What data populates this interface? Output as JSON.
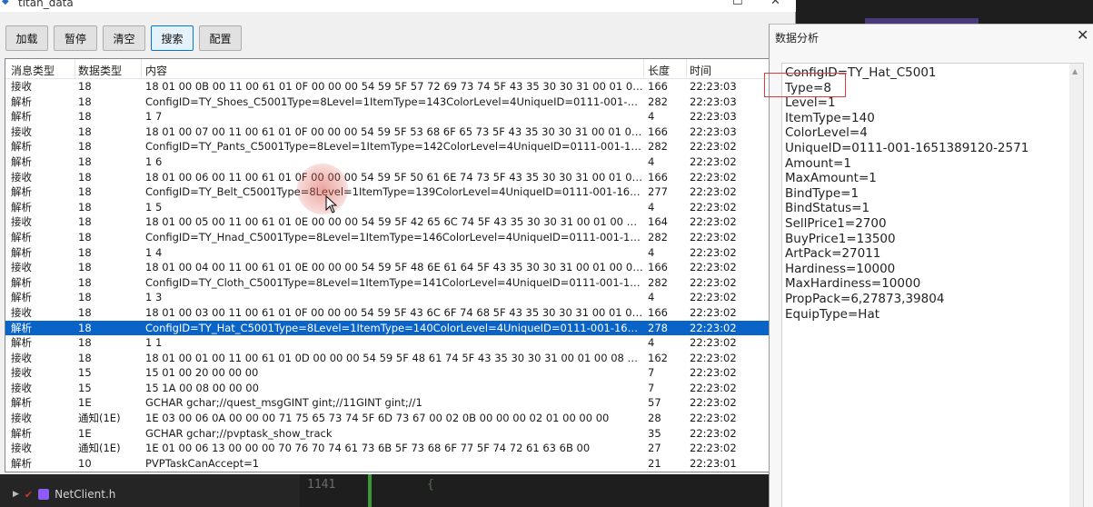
{
  "window": {
    "title": "titan_data"
  },
  "toolbar": {
    "buttons": [
      "加载",
      "暂停",
      "清空",
      "搜索",
      "配置"
    ]
  },
  "table": {
    "headers": [
      "消息类型",
      "数据类型",
      "内容",
      "长度",
      "时间"
    ],
    "rows": [
      [
        "接收",
        "18",
        "18 01 00 0B 00 11 00 61 01 0F 00 00 00 54 59 5F 57 72 69 73 74 5F 43 35 30 30 31 00 01 00 08 07 ...",
        "166",
        "22:23:03"
      ],
      [
        "解析",
        "18",
        "ConfigID=TY_Shoes_C5001Type=8Level=1ItemType=143ColorLevel=4UniqueID=0111-001-165138912...",
        "282",
        "22:23:03"
      ],
      [
        "解析",
        "18",
        "1 7",
        "4",
        "22:23:03"
      ],
      [
        "接收",
        "18",
        "18 01 00 07 00 11 00 61 01 0F 00 00 00 54 59 5F 53 68 6F 65 73 5F 43 35 30 30 31 00 01 00 08 07 ...",
        "166",
        "22:23:03"
      ],
      [
        "解析",
        "18",
        "ConfigID=TY_Pants_C5001Type=8Level=1ItemType=142ColorLevel=4UniqueID=0111-001-165138912...",
        "282",
        "22:23:02"
      ],
      [
        "解析",
        "18",
        "1 6",
        "4",
        "22:23:02"
      ],
      [
        "接收",
        "18",
        "18 01 00 06 00 11 00 61 01 0F 00 00 00 54 59 5F 50 61 6E 74 73 5F 43 35 30 30 31 00 01 00 08 07 ...",
        "166",
        "22:23:02"
      ],
      [
        "解析",
        "18",
        "ConfigID=TY_Belt_C5001Type=8Level=1ItemType=139ColorLevel=4UniqueID=0111-001-1651389120-...",
        "277",
        "22:23:02"
      ],
      [
        "解析",
        "18",
        "1 5",
        "4",
        "22:23:02"
      ],
      [
        "接收",
        "18",
        "18 01 00 05 00 11 00 61 01 0E 00 00 00 54 59 5F 42 65 6C 74 5F 43 35 30 30 31 00 01 00 08 07 00 ...",
        "164",
        "22:23:02"
      ],
      [
        "解析",
        "18",
        "ConfigID=TY_Hnad_C5001Type=8Level=1ItemType=146ColorLevel=4UniqueID=0111-001-165138912...",
        "282",
        "22:23:02"
      ],
      [
        "解析",
        "18",
        "1 4",
        "4",
        "22:23:02"
      ],
      [
        "接收",
        "18",
        "18 01 00 04 00 11 00 61 01 0E 00 00 00 54 59 5F 48 6E 61 64 5F 43 35 30 30 31 00 01 00 08 07 00 ...",
        "166",
        "22:23:02"
      ],
      [
        "解析",
        "18",
        "ConfigID=TY_Cloth_C5001Type=8Level=1ItemType=141ColorLevel=4UniqueID=0111-001-165138912...",
        "282",
        "22:23:02"
      ],
      [
        "解析",
        "18",
        "1 3",
        "4",
        "22:23:02"
      ],
      [
        "接收",
        "18",
        "18 01 00 03 00 11 00 61 01 0F 00 00 00 54 59 5F 43 6C 6F 74 68 5F 43 35 30 30 31 00 01 00 08 07 ...",
        "166",
        "22:23:02"
      ],
      [
        "解析",
        "18",
        "ConfigID=TY_Hat_C5001Type=8Level=1ItemType=140ColorLevel=4UniqueID=0111-001-1651389120-...",
        "278",
        "22:23:02"
      ],
      [
        "解析",
        "18",
        "1 1",
        "4",
        "22:23:02"
      ],
      [
        "接收",
        "18",
        "18 01 00 01 00 11 00 61 01 0D 00 00 00 54 59 5F 48 61 74 5F 43 35 30 30 31 00 01 00 08 07 00 01 ...",
        "162",
        "22:23:02"
      ],
      [
        "接收",
        "15",
        "15 01 00 20 00 00 00",
        "7",
        "22:23:02"
      ],
      [
        "接收",
        "15",
        "15 1A 00 08 00 00 00",
        "7",
        "22:23:02"
      ],
      [
        "解析",
        "1E",
        "GCHAR gchar;//quest_msgGINT gint;//11GINT gint;//1",
        "57",
        "22:23:02"
      ],
      [
        "接收",
        "通知(1E)",
        "1E 03 00 06 0A 00 00 00 71 75 65 73 74 5F 6D 73 67 00 02 0B 00 00 00 02 01 00 00 00",
        "28",
        "22:23:02"
      ],
      [
        "解析",
        "1E",
        "GCHAR gchar;//pvptask_show_track",
        "35",
        "22:23:02"
      ],
      [
        "接收",
        "通知(1E)",
        "1E 01 00 06 13 00 00 00 70 76 70 74 61 73 6B 5F 73 68 6F 77 5F 74 72 61 63 6B 00",
        "27",
        "22:23:02"
      ],
      [
        "解析",
        "10",
        "PVPTaskCanAccept=1",
        "21",
        "22:23:01"
      ]
    ],
    "selected_index": 16
  },
  "analysis": {
    "title": "数据分析",
    "lines": [
      "ConfigID=TY_Hat_C5001",
      "Type=8",
      "Level=1",
      "ItemType=140",
      "ColorLevel=4",
      "UniqueID=0111-001-1651389120-2571",
      "Amount=1",
      "MaxAmount=1",
      "BindType=1",
      "BindStatus=1",
      "SellPrice1=2700",
      "BuyPrice1=13500",
      "ArtPack=27011",
      "Hardiness=10000",
      "MaxHardiness=10000",
      "PropPack=6,27873,39804",
      "EquipType=Hat"
    ]
  },
  "ide": {
    "file_name": "NetClient.h",
    "line_number": "1141",
    "code_fragment": "{"
  },
  "colors": {
    "selection": "#0a64c8",
    "annotation": "#e03a3a"
  }
}
